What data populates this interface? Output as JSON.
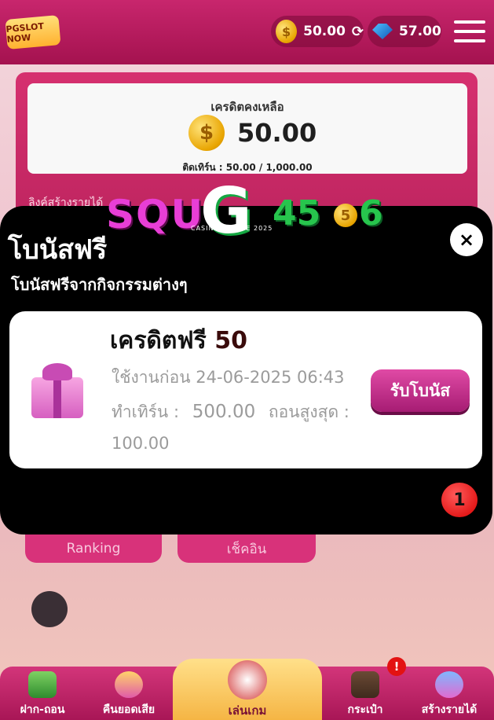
{
  "header": {
    "logo_text": "PGSLOT NOW",
    "credit_balance": "50.00",
    "gem_balance": "57.00"
  },
  "credit_card": {
    "title": "เครดิตคงเหลือ",
    "amount": "50.00",
    "turnover": "ติดเทิร์น : 50.00 / 1,000.00",
    "link_text": "ลิงค์สร้างรายได้"
  },
  "brand": {
    "part1": "SQU",
    "part2": "G",
    "part3": "45",
    "coin_digit": "5",
    "part4": "6",
    "subtitle": "CASINO ONLINE 2025"
  },
  "modal": {
    "title": "โบนัสฟรี",
    "subtitle": "โบนัสฟรีจากกิจกรรมต่างๆ",
    "close_symbol": "×",
    "count_badge": "1",
    "bonus": {
      "title": "เครดิตฟรี",
      "value": "50",
      "expire": "ใช้งานก่อน 24-06-2025 06:43",
      "turnover_label": "ทำเทิร์น :",
      "turnover_value": "500.00",
      "withdraw_label": "ถอนสูงสุด :",
      "withdraw_value": "100.00",
      "claim_button": "รับโบนัส"
    }
  },
  "under_buttons": {
    "ranking": "Ranking",
    "checkin": "เช็คอิน"
  },
  "bottom_nav": {
    "deposit": "ฝาก-ถอน",
    "refund": "คืนยอดเสีย",
    "play": "เล่นเกม",
    "wallet": "กระเป๋า",
    "affiliate": "สร้างรายได้",
    "alert": "!"
  }
}
